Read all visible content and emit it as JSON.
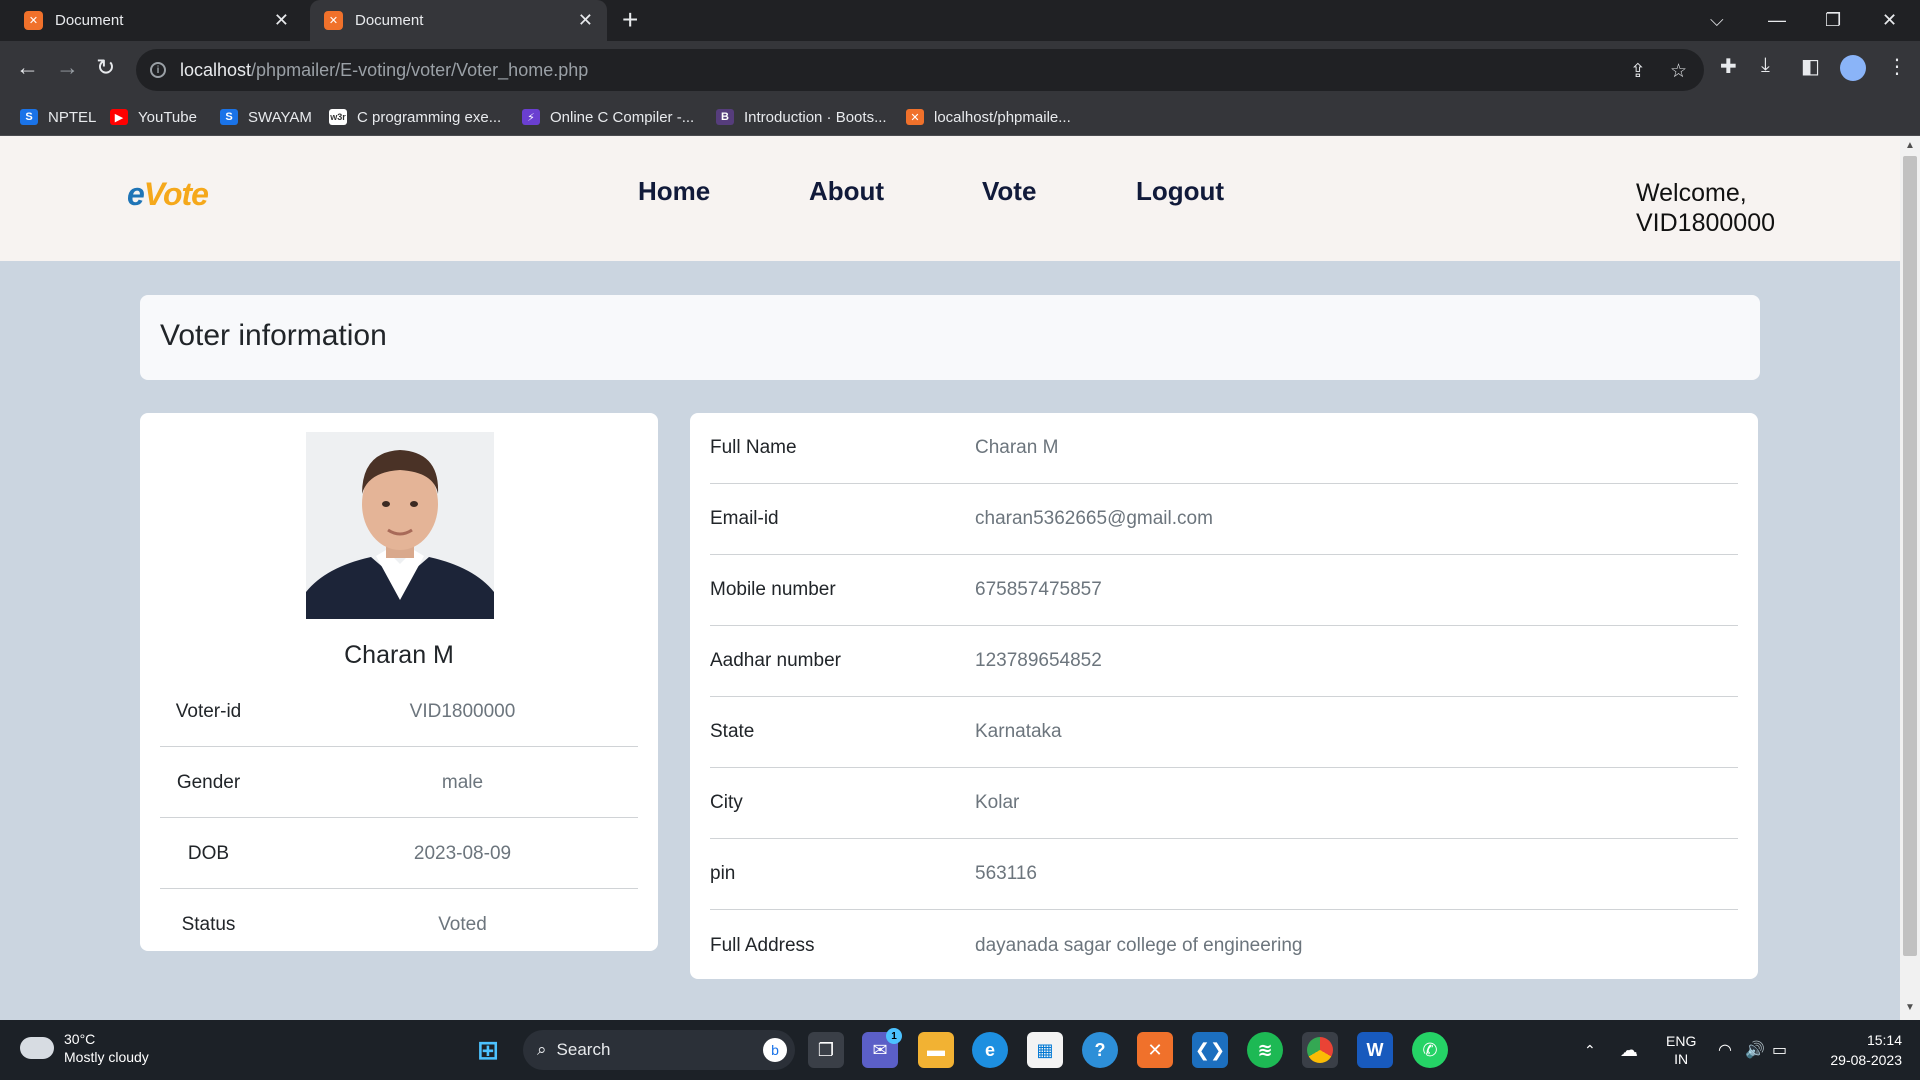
{
  "browser": {
    "tabs": [
      {
        "title": "Document",
        "active": false
      },
      {
        "title": "Document",
        "active": true
      }
    ],
    "address": {
      "host": "localhost",
      "path": "/phpmailer/E-voting/voter/Voter_home.php"
    },
    "bookmarks": [
      {
        "label": "NPTEL",
        "icon": "nptel-icon"
      },
      {
        "label": "YouTube",
        "icon": "youtube-icon"
      },
      {
        "label": "SWAYAM",
        "icon": "swayam-icon"
      },
      {
        "label": "C programming exe...",
        "icon": "w3r-icon"
      },
      {
        "label": "Online C Compiler -...",
        "icon": "compiler-icon"
      },
      {
        "label": "Introduction · Boots...",
        "icon": "bootstrap-icon"
      },
      {
        "label": "localhost/phpmaile...",
        "icon": "xampp-icon"
      }
    ]
  },
  "site": {
    "logo": {
      "e": "e",
      "rest": "Vote"
    },
    "nav": {
      "home": "Home",
      "about": "About",
      "vote": "Vote",
      "logout": "Logout"
    },
    "welcome_line1": "Welcome,",
    "welcome_line2": "VID1800000"
  },
  "section_title": "Voter information",
  "profile": {
    "name": "Charan M",
    "rows": [
      {
        "label": "Voter-id",
        "value": "VID1800000"
      },
      {
        "label": "Gender",
        "value": "male"
      },
      {
        "label": "DOB",
        "value": "2023-08-09"
      },
      {
        "label": "Status",
        "value": "Voted"
      }
    ]
  },
  "details": [
    {
      "label": "Full Name",
      "value": "Charan M"
    },
    {
      "label": "Email-id",
      "value": "charan5362665@gmail.com"
    },
    {
      "label": "Mobile number",
      "value": "675857475857"
    },
    {
      "label": "Aadhar number",
      "value": "123789654852"
    },
    {
      "label": "State",
      "value": "Karnataka"
    },
    {
      "label": "City",
      "value": "Kolar"
    },
    {
      "label": "pin",
      "value": "563116"
    },
    {
      "label": "Full Address",
      "value": "dayanada sagar college of engineering"
    }
  ],
  "taskbar": {
    "weather_temp": "30°C",
    "weather_desc": "Mostly cloudy",
    "search_label": "Search",
    "lang1": "ENG",
    "lang2": "IN",
    "time": "15:14",
    "date": "29-08-2023",
    "chat_badge": "1"
  }
}
